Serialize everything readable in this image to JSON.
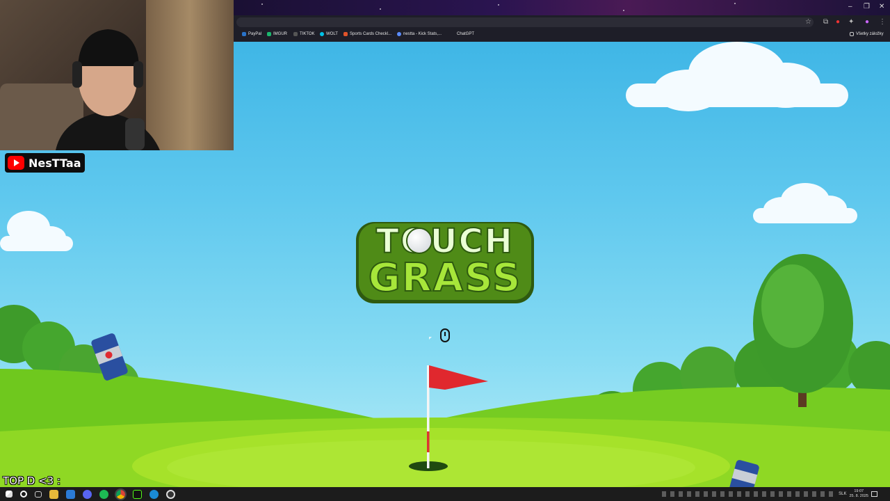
{
  "streamer": {
    "channel_name": "NesTTaa",
    "overlay_text": "TOP D <3 :"
  },
  "browser": {
    "bookmarks": [
      {
        "label": "PayPal",
        "icon": "paypal-icon",
        "color": "#2a73c9"
      },
      {
        "label": "IMGUR",
        "icon": "imgur-icon",
        "color": "#1bb76e"
      },
      {
        "label": "TIKTOK",
        "icon": "tiktok-icon",
        "color": "#222222"
      },
      {
        "label": "WOLT",
        "icon": "wolt-icon",
        "color": "#00c2e8"
      },
      {
        "label": "Sports Cards Checkl...",
        "icon": "sportscards-icon",
        "color": "#e0532a"
      },
      {
        "label": "nestta - Kick Stats,...",
        "icon": "kick-icon",
        "color": "#5a8cff"
      },
      {
        "label": "ChatGPT",
        "icon": "chatgpt-icon",
        "color": "#ffffff"
      }
    ],
    "all_bookmarks_label": "Všetky záložky",
    "window_controls": [
      "–",
      "❐",
      "✕"
    ]
  },
  "game": {
    "title_line1": "TOUCH",
    "title_line2": "GRASS",
    "mouse_hint_icon": "mouse-icon"
  },
  "taskbar": {
    "language": "SLK",
    "time": "19:07",
    "date": "25. 8. 2025"
  },
  "colors": {
    "sky_top": "#3fb6e6",
    "grass_light": "#a6e22a",
    "grass_dark": "#4caf1e",
    "title_green": "#9ee030",
    "flag_red": "#e0282e"
  }
}
